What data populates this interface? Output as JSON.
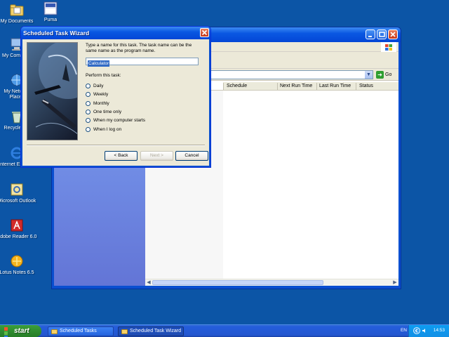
{
  "desktop": {
    "icons": [
      {
        "label": "My Documents"
      },
      {
        "label": "Puma"
      },
      {
        "label": "My Computer"
      },
      {
        "label": "My Network Places"
      },
      {
        "label": "Recycle Bin"
      },
      {
        "label": "Internet Explorer"
      },
      {
        "label": "Microsoft Outlook"
      },
      {
        "label": "Adobe Reader 6.0"
      },
      {
        "label": "Lotus Notes 6.5"
      }
    ]
  },
  "explorer": {
    "address_go_label": "Go",
    "columns": [
      "Schedule",
      "Next Run Time",
      "Last Run Time",
      "Status"
    ]
  },
  "wizard": {
    "title": "Scheduled Task Wizard",
    "intro_text": "Type a name for this task. The task name can be the same name as the program name.",
    "task_name_value": "Calculator",
    "perform_label": "Perform this task:",
    "options": [
      "Daily",
      "Weekly",
      "Monthly",
      "One time only",
      "When my computer starts",
      "When I log on"
    ],
    "back_label": "< Back",
    "next_label": "Next >",
    "cancel_label": "Cancel"
  },
  "taskbar": {
    "start_label": "start",
    "tasks": [
      "Scheduled Tasks",
      "Scheduled Task Wizard"
    ],
    "language": "EN",
    "clock": "14:53"
  },
  "colors": {
    "desktop": "#0c55a6",
    "titlebar": "#0a58e2",
    "dialog_face": "#ece9d8",
    "start_button": "#2f8d2f",
    "selection": "#316ac5"
  }
}
